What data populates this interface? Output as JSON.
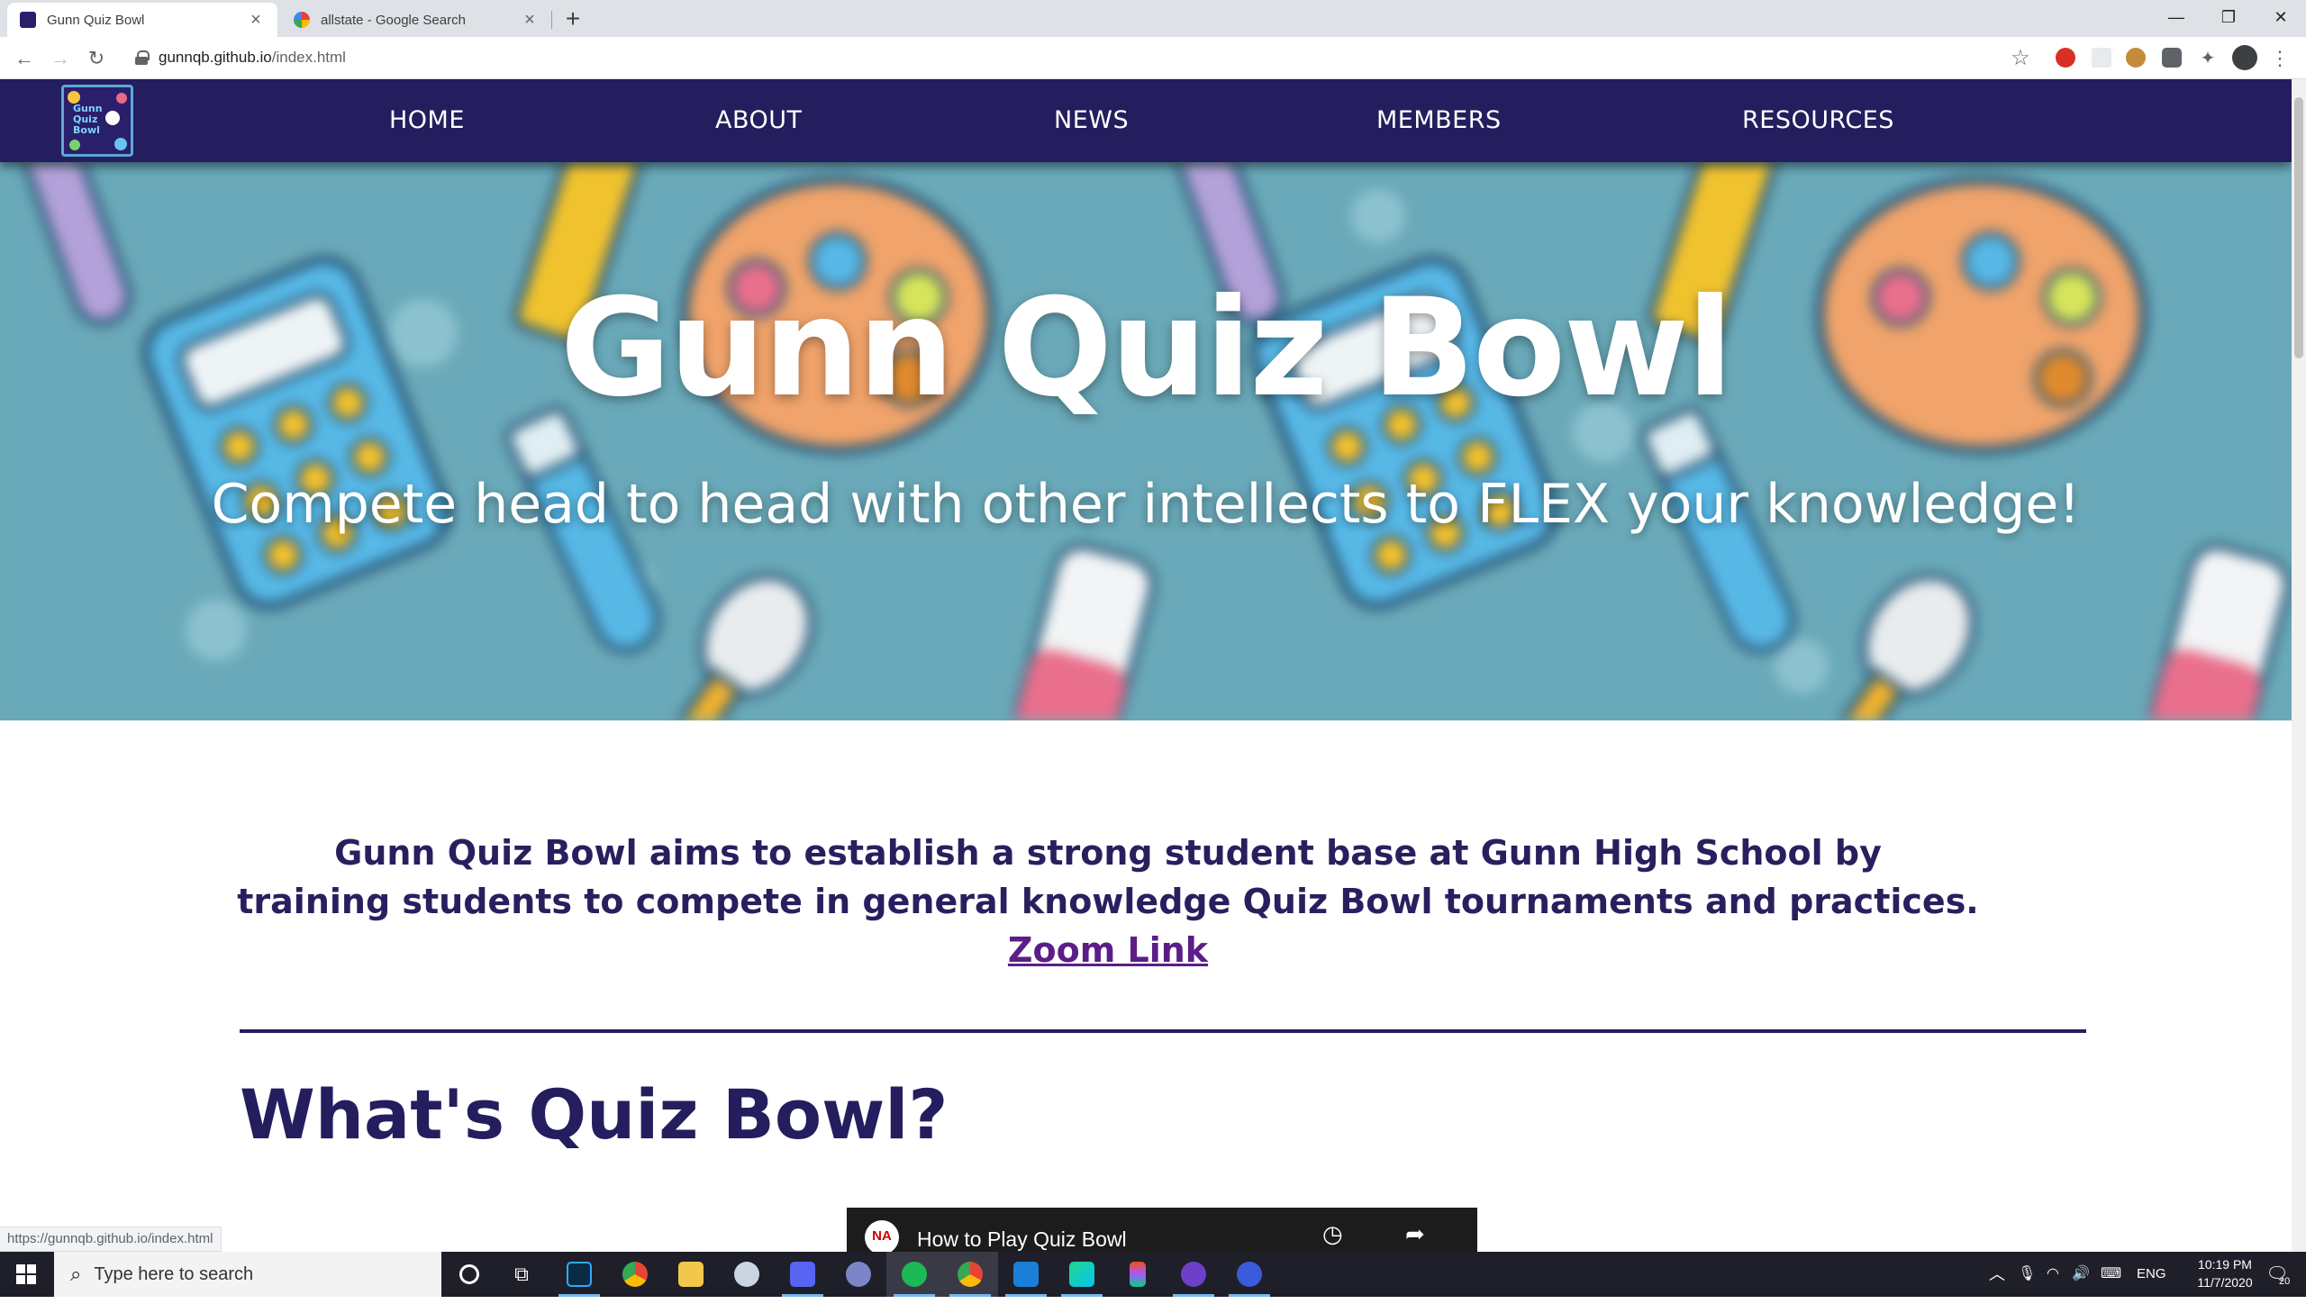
{
  "browser": {
    "tabs": [
      {
        "title": "Gunn Quiz Bowl",
        "active": true
      },
      {
        "title": "allstate - Google Search",
        "active": false
      }
    ],
    "url_host": "gunnqb.github.io",
    "url_path": "/index.html",
    "status_url": "https://gunnqb.github.io/index.html"
  },
  "site": {
    "nav": [
      "HOME",
      "ABOUT",
      "NEWS",
      "MEMBERS",
      "RESOURCES"
    ],
    "logo_text": [
      "Gunn",
      "Quiz",
      "Bowl"
    ],
    "hero_title": "Gunn Quiz Bowl",
    "hero_subtitle": "Compete head to head with other intellects to FLEX your knowledge!",
    "intro_line1": "Gunn Quiz Bowl aims to establish a strong student base at Gunn High School by",
    "intro_line2": "training students to compete in general knowledge Quiz Bowl tournaments and practices.",
    "zoom_link": "Zoom Link",
    "section_heading": "What's Quiz Bowl?",
    "video_title": "How to Play Quiz Bowl",
    "video_channel_badge": "NA"
  },
  "taskbar": {
    "search_placeholder": "Type here to search",
    "language": "ENG",
    "time": "10:19 PM",
    "date": "11/7/2020",
    "notification_count": "20"
  },
  "colors": {
    "nav_bg": "#241d5e",
    "heading": "#241d5e",
    "link": "#5b1e86",
    "hero_bg": "#6aa9b9"
  }
}
